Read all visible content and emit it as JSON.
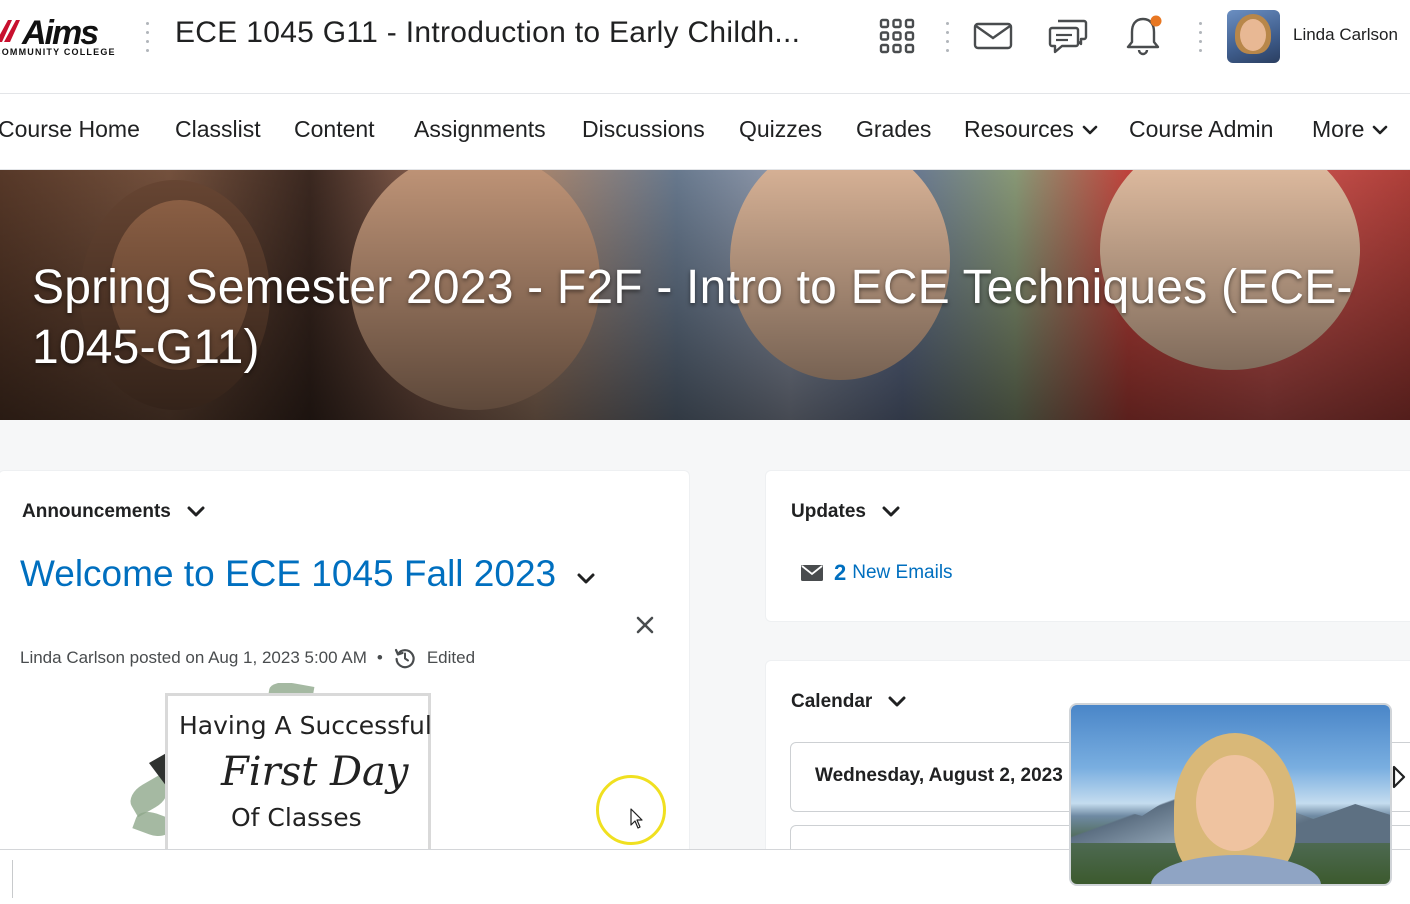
{
  "header": {
    "logo_text": "Aims",
    "logo_subtext": "COMMUNITY COLLEGE",
    "course_title": "ECE 1045 G11 - Introduction to Early Childh...",
    "user_name": "Linda Carlson",
    "icons": [
      "apps-grid-icon",
      "mail-icon",
      "chat-icon",
      "bell-icon"
    ],
    "notification_dot_color": "#e87722"
  },
  "nav": {
    "items": [
      {
        "label": "Course Home",
        "dropdown": false
      },
      {
        "label": "Classlist",
        "dropdown": false
      },
      {
        "label": "Content",
        "dropdown": false
      },
      {
        "label": "Assignments",
        "dropdown": false
      },
      {
        "label": "Discussions",
        "dropdown": false
      },
      {
        "label": "Quizzes",
        "dropdown": false
      },
      {
        "label": "Grades",
        "dropdown": false
      },
      {
        "label": "Resources",
        "dropdown": true
      },
      {
        "label": "Course Admin",
        "dropdown": false
      },
      {
        "label": "More",
        "dropdown": true
      }
    ]
  },
  "banner": {
    "title": "Spring Semester 2023 - F2F - Intro to ECE Techniques (ECE-1045-G11)"
  },
  "announcements": {
    "heading": "Announcements",
    "post_title": "Welcome to ECE 1045 Fall 2023",
    "posted_by": "Linda Carlson posted on Aug 1, 2023 5:00 AM",
    "separator": "•",
    "edited_label": "Edited",
    "image_text": {
      "line1": "Having A Successful",
      "line2": "First Day",
      "line3": "Of Classes"
    }
  },
  "updates": {
    "heading": "Updates",
    "email_count": "2",
    "email_label": "New Emails"
  },
  "calendar": {
    "heading": "Calendar",
    "date": "Wednesday, August 2, 2023"
  },
  "colors": {
    "link_blue": "#006fbf",
    "page_bg": "#f6f7f8",
    "cursor_highlight": "#f0e020"
  }
}
